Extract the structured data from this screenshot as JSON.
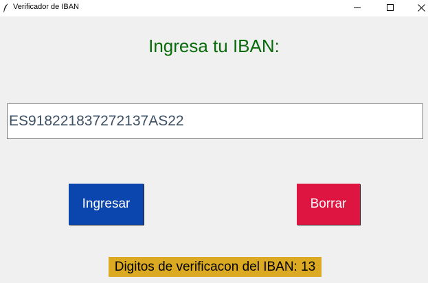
{
  "window": {
    "title": "Verificador de IBAN",
    "icon": "feather-icon",
    "controls": [
      "minimize-icon",
      "maximize-icon",
      "close-icon"
    ]
  },
  "main": {
    "heading": "Ingresa tu IBAN:",
    "iban_value": "ES918221837272137AS22",
    "ingresar_label": "Ingresar",
    "borrar_label": "Borrar",
    "result_text": "Digitos de verificacon del IBAN: 13"
  },
  "colors": {
    "heading": "#0a6b0a",
    "ingresar_bg": "#0b46ae",
    "borrar_bg": "#dd1540",
    "result_bg": "#dcaa22"
  }
}
